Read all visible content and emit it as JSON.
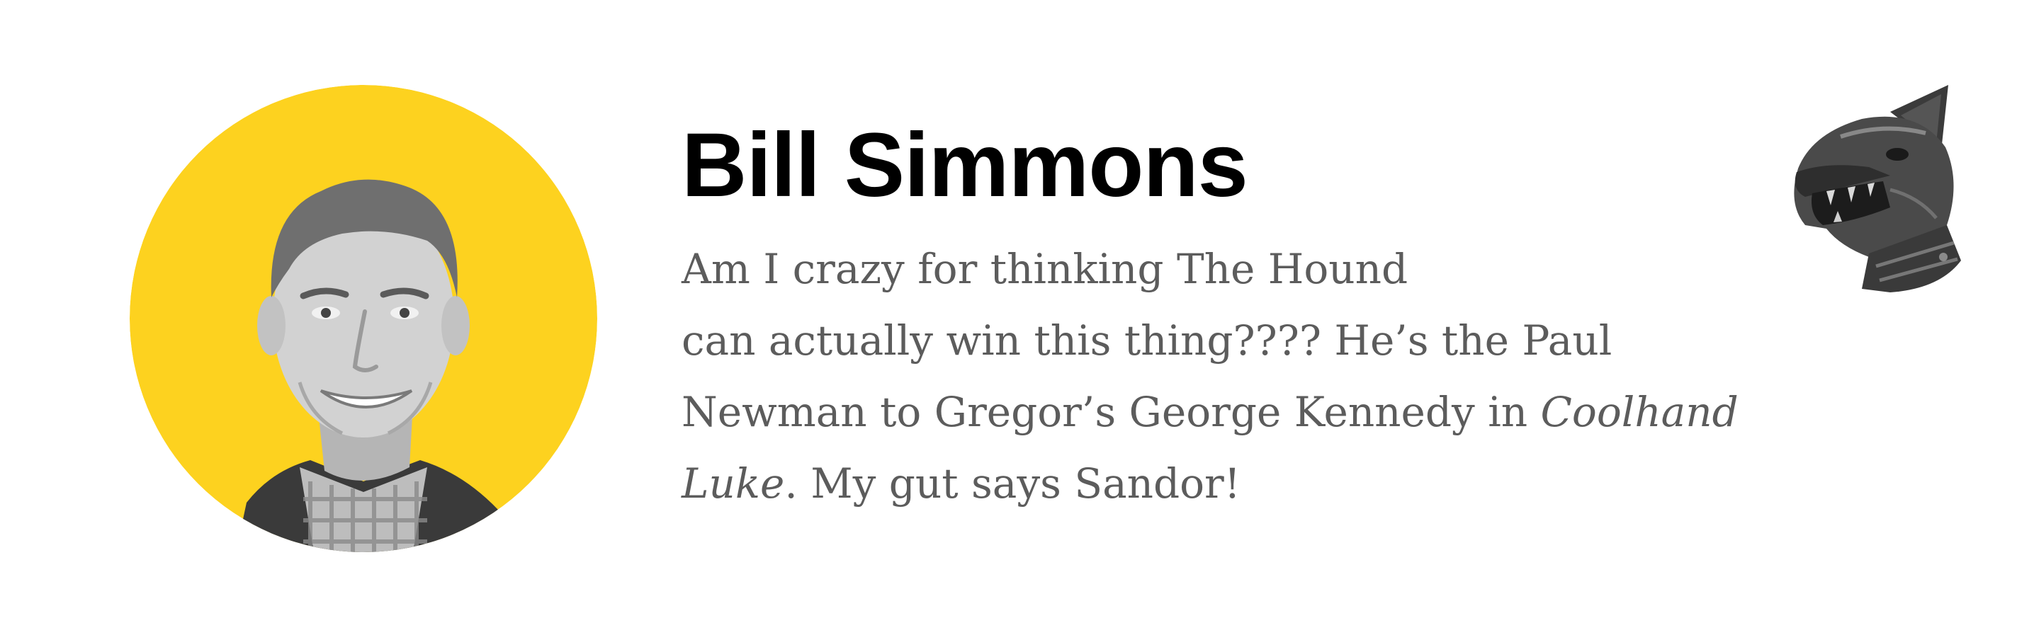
{
  "author": {
    "name": "Bill Simmons"
  },
  "quote": {
    "line1": "Am I crazy for thinking The Hound",
    "line2": "can actually win this thing???? He’s the Paul",
    "line3_text": "Newman to Gregor’s George Kennedy in ",
    "line3_em": "Coolhand",
    "line4_em": "Luke",
    "line4_text": ". My gut says Sandor!"
  },
  "colors": {
    "avatar_background": "#FDD21F",
    "name": "#000000",
    "quote_text": "#5C5C5C"
  },
  "icons": {
    "avatar": "person-photo",
    "helmet": "hound-helmet-icon"
  }
}
